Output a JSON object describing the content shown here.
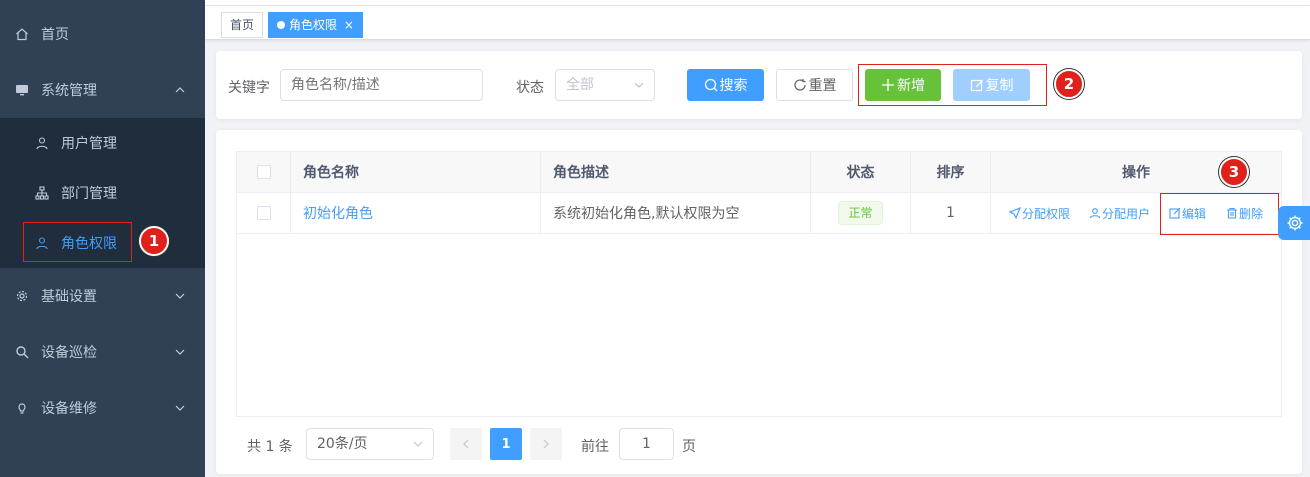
{
  "sidebar": {
    "items": [
      {
        "label": "首页",
        "icon": "home-icon"
      },
      {
        "label": "系统管理",
        "icon": "monitor-icon",
        "expanded": true
      },
      {
        "label": "基础设置",
        "icon": "gear-icon"
      },
      {
        "label": "设备巡检",
        "icon": "zoom-icon"
      },
      {
        "label": "设备维修",
        "icon": "bulb-icon"
      }
    ],
    "sub_items": [
      {
        "label": "用户管理",
        "icon": "user-icon"
      },
      {
        "label": "部门管理",
        "icon": "tree-icon"
      },
      {
        "label": "角色权限",
        "icon": "peoples-icon",
        "active": true
      }
    ]
  },
  "tags": [
    {
      "label": "首页"
    },
    {
      "label": "角色权限",
      "close": "×",
      "active": true
    }
  ],
  "search": {
    "keyword_label": "关键字",
    "keyword_placeholder": "角色名称/描述",
    "status_label": "状态",
    "status_value": "全部",
    "search_btn": "搜索",
    "reset_btn": "重置",
    "add_btn": "新增",
    "copy_btn": "复制"
  },
  "badges": [
    "1",
    "2",
    "3"
  ],
  "table": {
    "headers": [
      "角色名称",
      "角色描述",
      "状态",
      "排序",
      "操作"
    ],
    "rows": [
      {
        "name": "初始化角色",
        "desc": "系统初始化角色,默认权限为空",
        "status": "正常",
        "sort": "1",
        "ops": [
          "分配权限",
          "分配用户",
          "编辑",
          "删除"
        ]
      }
    ]
  },
  "pagination": {
    "total": "共 1 条",
    "page_size": "20条/页",
    "current": "1",
    "goto_label": "前往",
    "goto_value": "1",
    "page_suffix": "页"
  },
  "colors": {
    "primary": "#409eff",
    "success": "#67c23a",
    "sidebar_bg": "#304156",
    "annotation_red": "#e0211b"
  }
}
